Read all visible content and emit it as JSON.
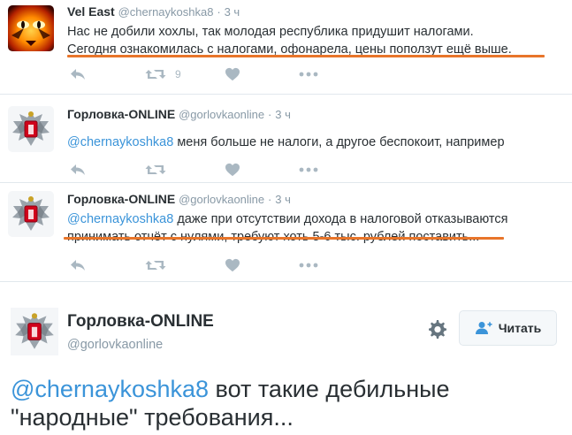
{
  "tweets": [
    {
      "avatar": "tiger-eye-avatar",
      "name": "Vel East",
      "handle": "@chernaykoshka8",
      "dot": "·",
      "time": "3 ч",
      "line1": "Нас не добили хохлы, так молодая республика придушит налогами.",
      "line2": "Сегодня ознакомилась с налогами, офонарела, цены поползут ещё выше.",
      "retweets": "9"
    },
    {
      "avatar": "dpr-eagle-avatar",
      "name": "Горловка-ONLINE",
      "handle": "@gorlovkaonline",
      "dot": "·",
      "time": "3 ч",
      "mention": "@chernaykoshka8",
      "line1": " меня больше не налоги, а другое беспокоит, например"
    },
    {
      "avatar": "dpr-eagle-avatar",
      "name": "Горловка-ONLINE",
      "handle": "@gorlovkaonline",
      "dot": "·",
      "time": "3 ч",
      "mention": "@chernaykoshka8",
      "line1": " даже при отсутствии дохода в налоговой отказываются",
      "line2": "принимать отчёт с нулями, требуют хоть 5-6 тыс. рублей поставить..."
    }
  ],
  "profile": {
    "name": "Горловка-ONLINE",
    "handle": "@gorlovkaonline",
    "follow_label": "Читать",
    "mention": "@chernaykoshka8",
    "text_a": " вот такие дебильные",
    "text_b": "\"народные\" требования..."
  },
  "colors": {
    "link": "#3b94d9",
    "underline": "#e8752a",
    "icon": "#aab8c2",
    "muted": "#8899a6"
  },
  "icons": [
    "reply-icon",
    "retweet-icon",
    "heart-icon",
    "more-icon",
    "gear-icon",
    "add-user-icon"
  ]
}
